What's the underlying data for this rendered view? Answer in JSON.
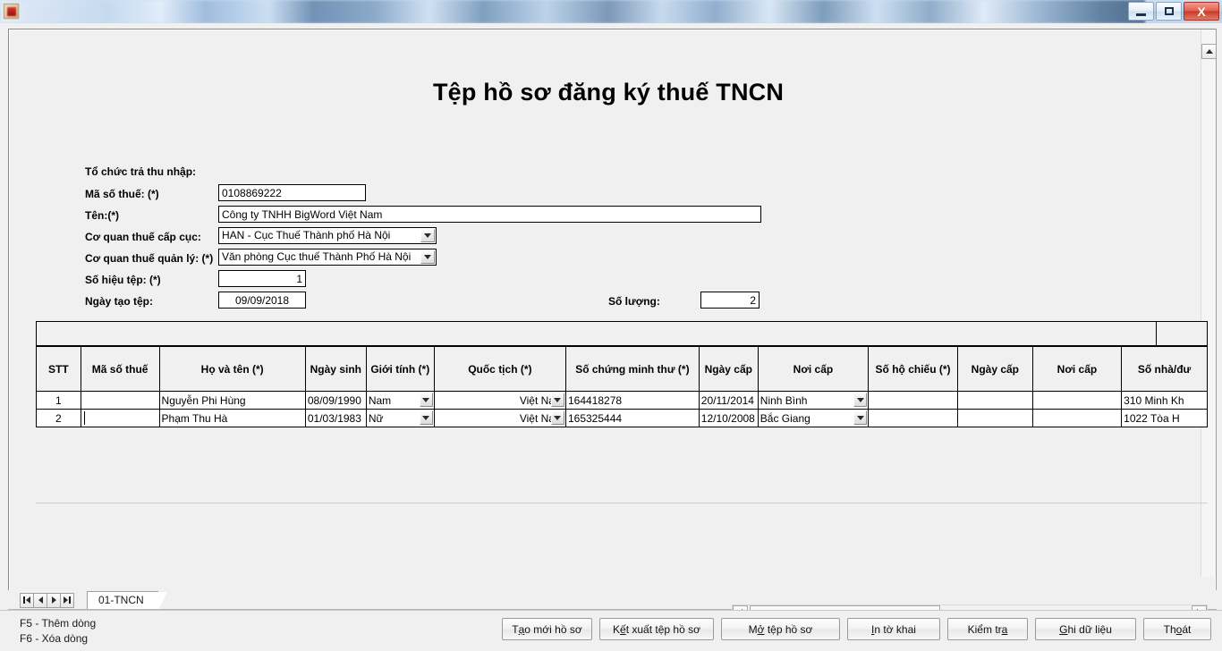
{
  "window": {
    "minimize_label": "Minimize",
    "maximize_label": "Maximize",
    "close_label": "X"
  },
  "page_title": "Tệp hồ sơ đăng ký thuế TNCN",
  "form": {
    "org_section_label": "Tổ chức trả thu nhập:",
    "fields": [
      {
        "label": "Mã số thuế: (*)",
        "value": "0108869222"
      },
      {
        "label": "Tên:(*)",
        "value": "Công ty TNHH BigWord Việt Nam"
      },
      {
        "label": "Cơ quan thuế cấp cục:",
        "value": "HAN - Cục Thuế Thành phố Hà Nội"
      },
      {
        "label": "Cơ quan thuế quản lý: (*)",
        "value": "Văn phòng Cục thuế Thành Phố Hà Nội"
      },
      {
        "label": "Số hiệu tệp: (*)",
        "value": "1"
      },
      {
        "label": "Ngày tạo tệp:",
        "value": "09/09/2018"
      }
    ],
    "quantity_label": "Số lượng:",
    "quantity_value": "2"
  },
  "grid": {
    "columns": [
      "STT",
      "Mã số thuế",
      "Họ và tên (*)",
      "Ngày sinh",
      "Giới tính (*)",
      "Quốc tịch (*)",
      "Số chứng minh thư (*)",
      "Ngày cấp",
      "Nơi cấp",
      "Số hộ chiếu (*)",
      "Ngày cấp",
      "Nơi cấp",
      "Số nhà/đư"
    ],
    "rows": [
      {
        "stt": "1",
        "tax_code": "",
        "full_name": "Nguyễn Phi Hùng",
        "birth_date": "08/09/1990",
        "gender": "Nam",
        "nationality": "Việt Nam",
        "id_number": "164418278",
        "id_issue_date": "20/11/2014",
        "id_issue_place": "Ninh Bình",
        "passport_number": "",
        "passport_issue_date": "",
        "passport_issue_place": "",
        "address": "310 Minh Kh"
      },
      {
        "stt": "2",
        "tax_code": "",
        "full_name": "Phạm Thu Hà",
        "birth_date": "01/03/1983",
        "gender": "Nữ",
        "nationality": "Việt Nam",
        "id_number": "165325444",
        "id_issue_date": "12/10/2008",
        "id_issue_place": "Bắc Giang",
        "passport_number": "",
        "passport_issue_date": "",
        "passport_issue_place": "",
        "address": "1022 Tòa H"
      }
    ]
  },
  "sheet_tab": {
    "name": "01-TNCN"
  },
  "footer": {
    "hint_line_1": "F5 - Thêm dòng",
    "hint_line_2": "F6 - Xóa dòng",
    "buttons": [
      {
        "pre": "T",
        "accel": "ạ",
        "post": "o mới hồ sơ"
      },
      {
        "pre": "K",
        "accel": "ế",
        "post": "t xuất tệp hồ sơ"
      },
      {
        "pre": "M",
        "accel": "ở",
        "post": " tệp hồ sơ"
      },
      {
        "pre": "",
        "accel": "I",
        "post": "n tờ khai"
      },
      {
        "pre": "Kiểm tr",
        "accel": "a",
        "post": ""
      },
      {
        "pre": "",
        "accel": "G",
        "post": "hi dữ liệu"
      },
      {
        "pre": "Th",
        "accel": "o",
        "post": "át"
      }
    ]
  }
}
